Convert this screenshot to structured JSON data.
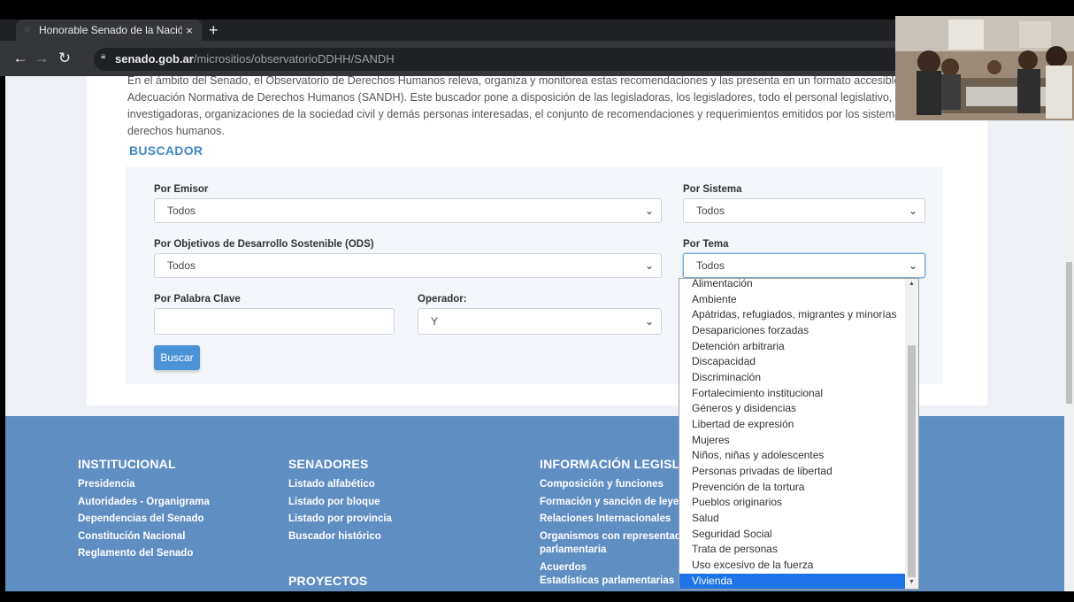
{
  "browser": {
    "tab_title": "Honorable Senado de la Nación",
    "tab_close": "×",
    "new_tab": "+",
    "url_domain": "senado.gob.ar",
    "url_path": "/micrositios/observatorioDDHH/SANDH"
  },
  "intro": {
    "lines": [
      "En el ámbito del Senado, el Observatorio de Derechos Humanos releva, organiza y monitorea estas recomendaciones y las presenta en un formato accesible, a través del Sistema de",
      "Adecuación Normativa de Derechos Humanos (SANDH). Este buscador pone a disposición de las legisladoras, los legisladores, todo el personal legislativo, investigadores e",
      "investigadoras, organizaciones de la sociedad civil y demás personas interesadas, el conjunto de recomendaciones y requerimientos emitidos por los sistemas universal y regional de",
      "derechos humanos."
    ]
  },
  "buscador": {
    "heading": "BUSCADOR",
    "emisor_label": "Por Emisor",
    "emisor_value": "Todos",
    "sistema_label": "Por Sistema",
    "sistema_value": "Todos",
    "ods_label": "Por Objetivos de Desarrollo Sostenible (ODS)",
    "ods_value": "Todos",
    "tema_label": "Por Tema",
    "tema_value": "Todos",
    "palabra_label": "Por Palabra Clave",
    "palabra_value": "",
    "operador_label": "Operador:",
    "operador_value": "Y",
    "buscar_label": "Buscar"
  },
  "tema_options": [
    "Alimentación",
    "Ambiente",
    "Apátridas, refugiados, migrantes y minorías",
    "Desapariciones forzadas",
    "Detención arbitraria",
    "Discapacidad",
    "Discriminación",
    "Fortalecimiento institucional",
    "Géneros y disidencias",
    "Libertad de expresión",
    "Mujeres",
    "Niños, niñas y adolescentes",
    "Personas privadas de libertad",
    "Prevención de la tortura",
    "Pueblos originarios",
    "Salud",
    "Seguridad Social",
    "Trata de personas",
    "Uso excesivo de la fuerza",
    "Vivienda"
  ],
  "tema_selected_option": "Vivienda",
  "footer": {
    "institucional": {
      "heading": "INSTITUCIONAL",
      "links": [
        "Presidencia",
        "Autoridades - Organigrama",
        "Dependencias del Senado",
        "Constitución Nacional",
        "Reglamento del Senado"
      ]
    },
    "senadores": {
      "heading": "SENADORES",
      "links": [
        "Listado alfabético",
        "Listado por bloque",
        "Listado por provincia",
        "Buscador histórico"
      ]
    },
    "proyectos": {
      "heading": "PROYECTOS"
    },
    "info_legislativa": {
      "heading": "INFORMACIÓN LEGISLATIVA",
      "links": [
        "Composición y funciones",
        "Formación y sanción de leyes",
        "Relaciones Internacionales",
        "Organismos con representación",
        "parlamentaria",
        "Acuerdos",
        "Estadísticas parlamentarias"
      ]
    }
  }
}
